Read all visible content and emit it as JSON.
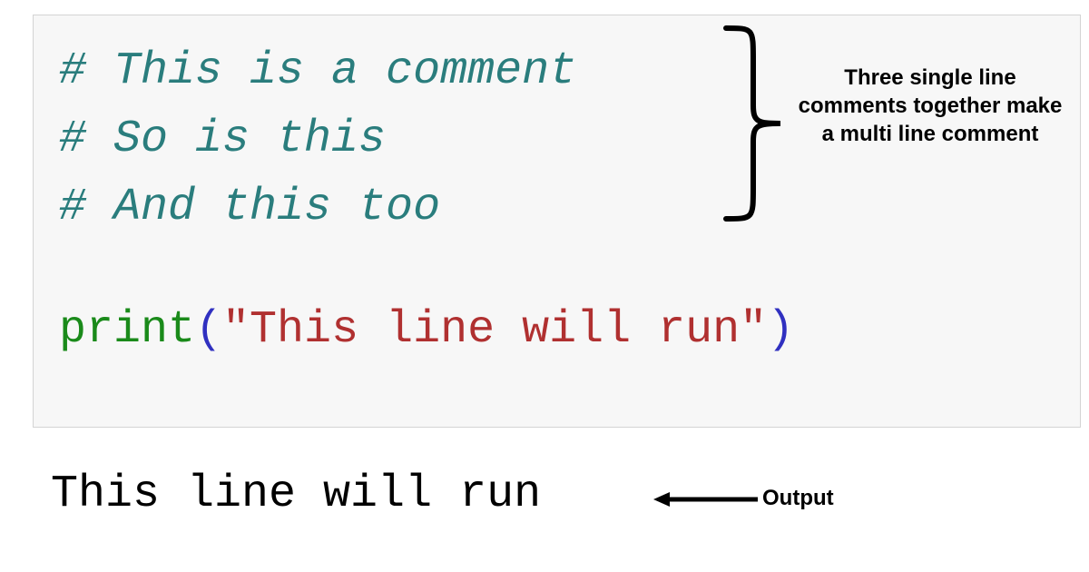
{
  "code": {
    "comment1": "# This is a comment",
    "comment2": "# So is this",
    "comment3": "# And this too",
    "print_fn": "print",
    "print_open": "(",
    "print_str": "\"This line will run\"",
    "print_close": ")"
  },
  "annotations": {
    "brace_label": "Three single line comments together make a multi line comment",
    "output_label": "Output"
  },
  "output": {
    "text": "This line will run"
  }
}
